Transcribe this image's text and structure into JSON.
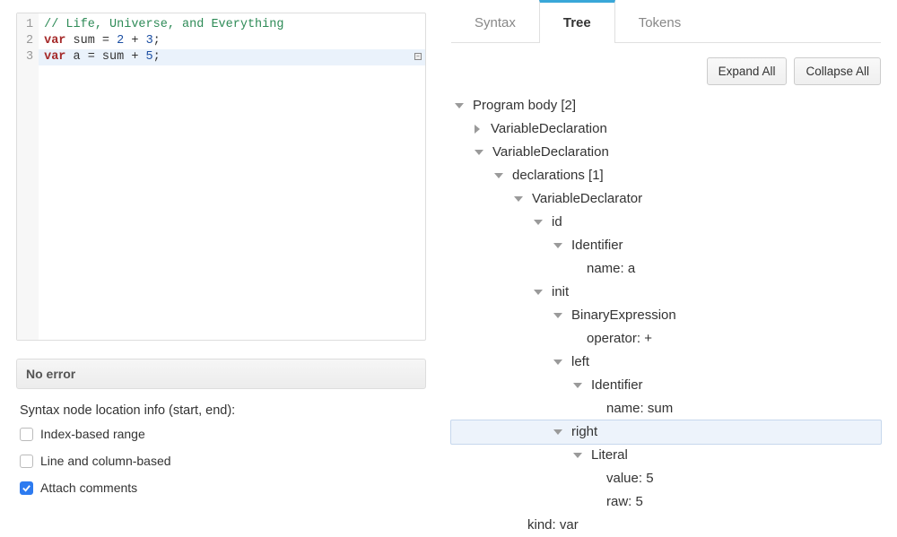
{
  "editor": {
    "lines": [
      {
        "num": "1",
        "tokens": [
          {
            "t": "// Life, Universe, and Everything",
            "c": "comment"
          }
        ]
      },
      {
        "num": "2",
        "tokens": [
          {
            "t": "var",
            "c": "keyword"
          },
          {
            "t": " sum = ",
            "c": ""
          },
          {
            "t": "2",
            "c": "num"
          },
          {
            "t": " + ",
            "c": ""
          },
          {
            "t": "3",
            "c": "num"
          },
          {
            "t": ";",
            "c": ""
          }
        ]
      },
      {
        "num": "3",
        "tokens": [
          {
            "t": "var",
            "c": "keyword"
          },
          {
            "t": " a = sum + ",
            "c": ""
          },
          {
            "t": "5",
            "c": "num"
          },
          {
            "t": ";",
            "c": ""
          }
        ]
      }
    ],
    "highlighted_line_index": 2
  },
  "status": {
    "text": "No error"
  },
  "options": {
    "title": "Syntax node location info (start, end):",
    "items": [
      {
        "label": "Index-based range",
        "checked": false
      },
      {
        "label": "Line and column-based",
        "checked": false
      },
      {
        "label": "Attach comments",
        "checked": true
      }
    ]
  },
  "tabs": {
    "items": [
      {
        "label": "Syntax",
        "active": false
      },
      {
        "label": "Tree",
        "active": true
      },
      {
        "label": "Tokens",
        "active": false
      }
    ]
  },
  "toolbar": {
    "expand_label": "Expand All",
    "collapse_label": "Collapse All"
  },
  "tree": {
    "rows": [
      {
        "indent": 0,
        "arrow": "down",
        "label": "Program body [2]",
        "selected": false
      },
      {
        "indent": 1,
        "arrow": "right",
        "label": "VariableDeclaration",
        "selected": false
      },
      {
        "indent": 1,
        "arrow": "down",
        "label": "VariableDeclaration",
        "selected": false
      },
      {
        "indent": 2,
        "arrow": "down",
        "label": "declarations [1]",
        "selected": false
      },
      {
        "indent": 3,
        "arrow": "down",
        "label": "VariableDeclarator",
        "selected": false
      },
      {
        "indent": 4,
        "arrow": "down",
        "label": "id",
        "selected": false
      },
      {
        "indent": 5,
        "arrow": "down",
        "label": "Identifier",
        "selected": false
      },
      {
        "indent": 6,
        "arrow": "none",
        "label": "name: a",
        "selected": false
      },
      {
        "indent": 4,
        "arrow": "down",
        "label": "init",
        "selected": false
      },
      {
        "indent": 5,
        "arrow": "down",
        "label": "BinaryExpression",
        "selected": false
      },
      {
        "indent": 6,
        "arrow": "none",
        "label": "operator: +",
        "selected": false
      },
      {
        "indent": 5,
        "arrow": "down",
        "label": "left",
        "selected": false
      },
      {
        "indent": 6,
        "arrow": "down",
        "label": "Identifier",
        "selected": false
      },
      {
        "indent": 7,
        "arrow": "none",
        "label": "name: sum",
        "selected": false
      },
      {
        "indent": 5,
        "arrow": "down",
        "label": "right",
        "selected": true
      },
      {
        "indent": 6,
        "arrow": "down",
        "label": "Literal",
        "selected": false
      },
      {
        "indent": 7,
        "arrow": "none",
        "label": "value: 5",
        "selected": false
      },
      {
        "indent": 7,
        "arrow": "none",
        "label": "raw: 5",
        "selected": false
      },
      {
        "indent": 3,
        "arrow": "none",
        "label": "kind: var",
        "selected": false
      }
    ]
  }
}
